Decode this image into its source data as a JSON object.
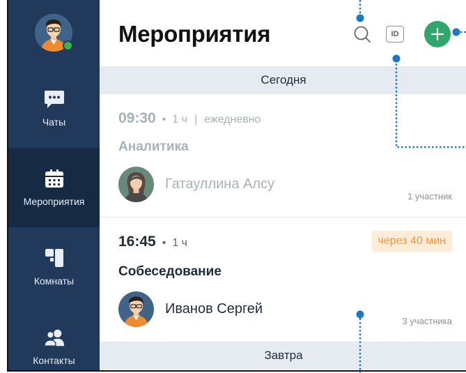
{
  "sidebar": {
    "user_status": "online",
    "items": [
      {
        "label": "Чаты",
        "icon": "chat-icon",
        "active": false
      },
      {
        "label": "Мероприятия",
        "icon": "calendar-icon",
        "active": true
      },
      {
        "label": "Комнаты",
        "icon": "rooms-icon",
        "active": false
      },
      {
        "label": "Контакты",
        "icon": "contacts-icon",
        "active": false
      }
    ]
  },
  "header": {
    "title": "Мероприятия",
    "search_icon": "search-icon",
    "id_label": "ID",
    "add_icon": "plus-icon"
  },
  "sections": {
    "today": "Сегодня",
    "tomorrow": "Завтра"
  },
  "events": [
    {
      "time": "09:30",
      "sep": "•",
      "duration": "1 ч",
      "bar": "|",
      "repeat": "ежедневно",
      "title": "Аналитика",
      "person": "Гатауллина Алсу",
      "participants": "1 участник",
      "state": "past"
    },
    {
      "time": "16:45",
      "sep": "•",
      "duration": "1 ч",
      "badge": "через 40 мин",
      "title": "Собеседование",
      "person": "Иванов Сергей",
      "participants": "3 участника",
      "state": "upcoming"
    }
  ],
  "colors": {
    "sidebar": "#213a5c",
    "sidebar_active": "#172a44",
    "accent_green": "#2fa66c",
    "annotation_blue": "#1f77c4",
    "badge_orange": "#f3963f"
  }
}
